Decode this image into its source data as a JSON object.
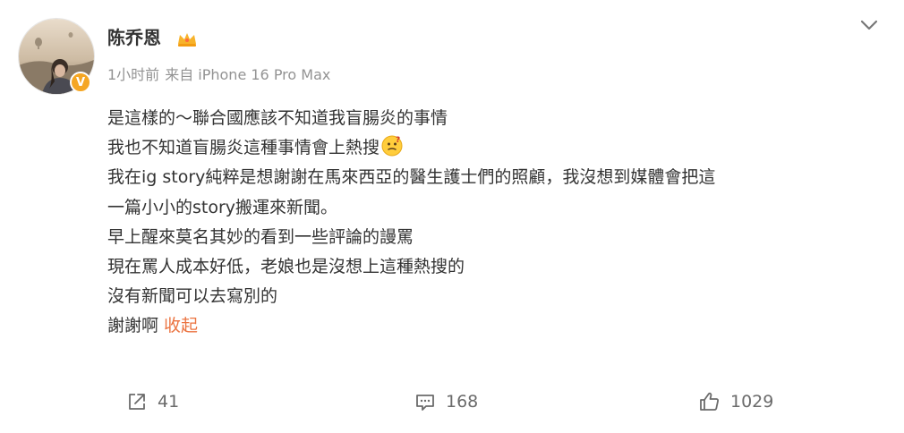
{
  "post": {
    "author": {
      "name": "陈乔恩",
      "avatar_icon": "profile-photo",
      "verified_badge_icon": "verified-v-icon",
      "vip_icon": "crown-icon"
    },
    "time": "1小时前",
    "source": "来自 iPhone 16 Pro Max",
    "more_icon": "chevron-down-icon",
    "lines": [
      "是這樣的～聯合國應該不知道我盲腸炎的事情",
      "我也不知道盲腸炎這種事情會上熱搜",
      "我在ig story純粹是想謝謝在馬來西亞的醫生護士們的照顧，我沒想到媒體會把這",
      "一篇小小的story搬運來新聞。",
      "早上醒來莫名其妙的看到一些評論的謾罵",
      "現在罵人成本好低，老娘也是沒想上這種熱搜的",
      "沒有新聞可以去寫別的",
      "謝謝啊"
    ],
    "emoji_icon": "thinking-face-emoji",
    "collapse_label": "收起",
    "collapse_color": "#eb7340",
    "actions": {
      "share_count": "41",
      "comment_count": "168",
      "like_count": "1029"
    }
  }
}
